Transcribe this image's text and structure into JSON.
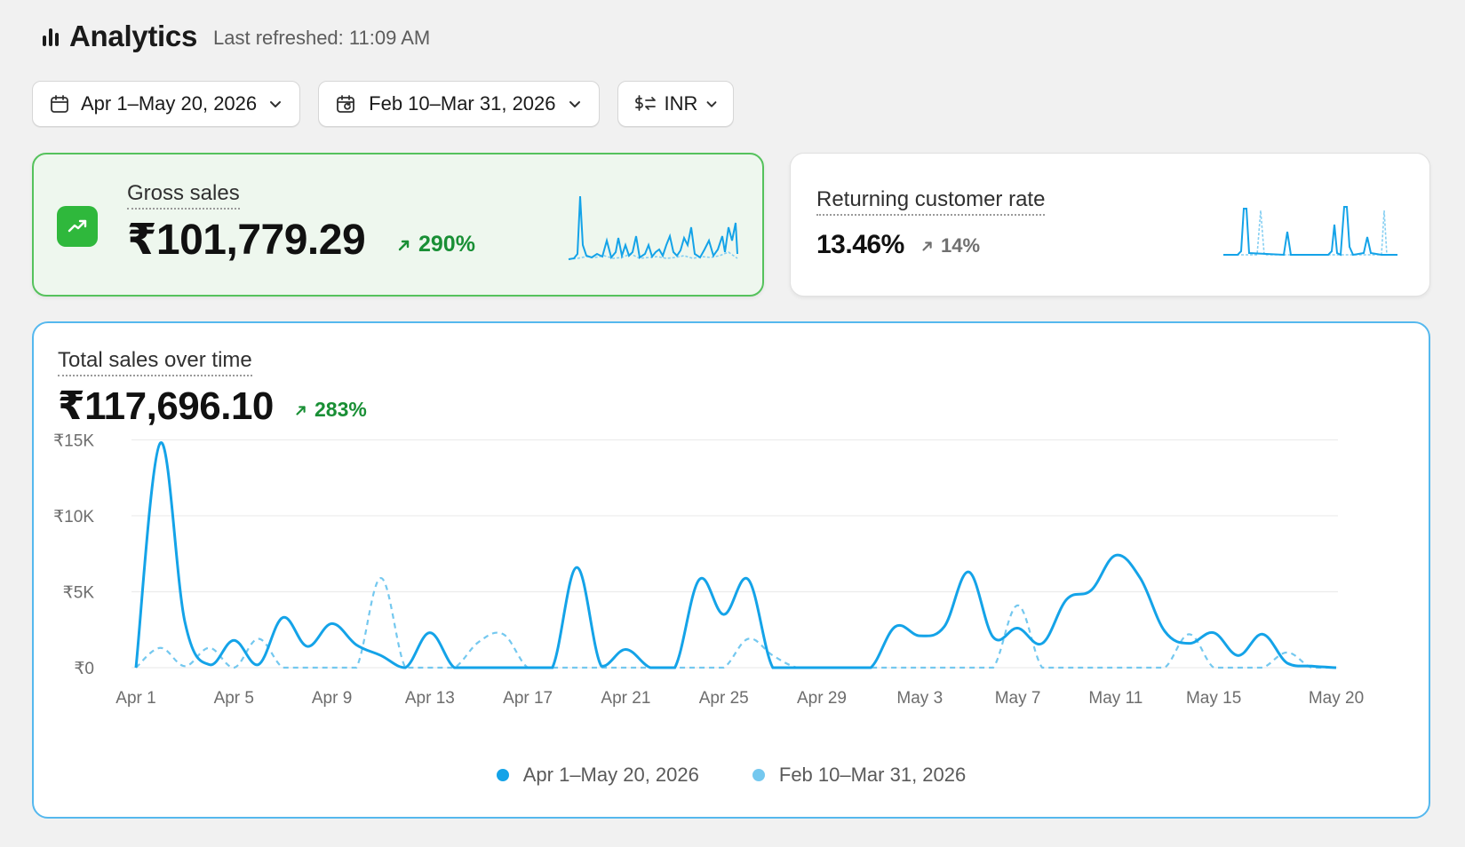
{
  "header": {
    "title": "Analytics",
    "last_refreshed": "Last refreshed: 11:09 AM"
  },
  "filters": {
    "date_range": "Apr 1–May 20, 2026",
    "compare_range": "Feb 10–Mar 31, 2026",
    "currency": "INR"
  },
  "kpis": {
    "gross_sales": {
      "label": "Gross sales",
      "value": "₹101,779.29",
      "change": "290%",
      "trend": "up"
    },
    "returning_customer_rate": {
      "label": "Returning customer rate",
      "value": "13.46%",
      "change": "14%",
      "trend": "up"
    }
  },
  "main_chart": {
    "label": "Total sales over time",
    "value": "₹117,696.10",
    "change": "283%"
  },
  "colors": {
    "primary_series": "#14a3e8",
    "comparison_series": "#74c8ef",
    "positive": "#198f35",
    "accent_border": "#55b8ee"
  },
  "chart_data": {
    "type": "line",
    "y_tick_labels": [
      "₹0",
      "₹5K",
      "₹10K",
      "₹15K"
    ],
    "y_ticks": [
      0,
      5000,
      10000,
      15000
    ],
    "ylim": [
      0,
      15200
    ],
    "x_tick_labels": [
      "Apr 1",
      "Apr 5",
      "Apr 9",
      "Apr 13",
      "Apr 17",
      "Apr 21",
      "Apr 25",
      "Apr 29",
      "May 3",
      "May 7",
      "May 11",
      "May 15",
      "May 20"
    ],
    "x_tick_days": [
      0,
      4,
      8,
      12,
      16,
      20,
      24,
      28,
      32,
      36,
      40,
      44,
      49
    ],
    "grid": true,
    "legend_position": "bottom-center",
    "series": [
      {
        "name": "Apr 1–May 20, 2026",
        "style": "solid",
        "values": [
          0,
          14800,
          3000,
          200,
          1800,
          200,
          3300,
          1400,
          2900,
          1500,
          800,
          0,
          2300,
          0,
          0,
          0,
          0,
          0,
          6600,
          100,
          1200,
          0,
          0,
          5800,
          3500,
          5800,
          0,
          0,
          0,
          0,
          0,
          2700,
          2100,
          2700,
          6300,
          2000,
          2600,
          1600,
          4500,
          5100,
          7400,
          5900,
          2400,
          1600,
          2300,
          800,
          2200,
          300,
          100,
          0
        ]
      },
      {
        "name": "Feb 10–Mar 31, 2026",
        "style": "dashed",
        "values": [
          0,
          1300,
          100,
          1300,
          0,
          1900,
          0,
          0,
          0,
          0,
          5900,
          0,
          0,
          0,
          1700,
          2200,
          0,
          0,
          0,
          0,
          0,
          0,
          0,
          0,
          0,
          1900,
          800,
          0,
          0,
          0,
          0,
          0,
          0,
          0,
          0,
          0,
          4100,
          0,
          0,
          0,
          0,
          0,
          0,
          2200,
          0,
          0,
          0,
          1000,
          0,
          0
        ]
      }
    ]
  }
}
